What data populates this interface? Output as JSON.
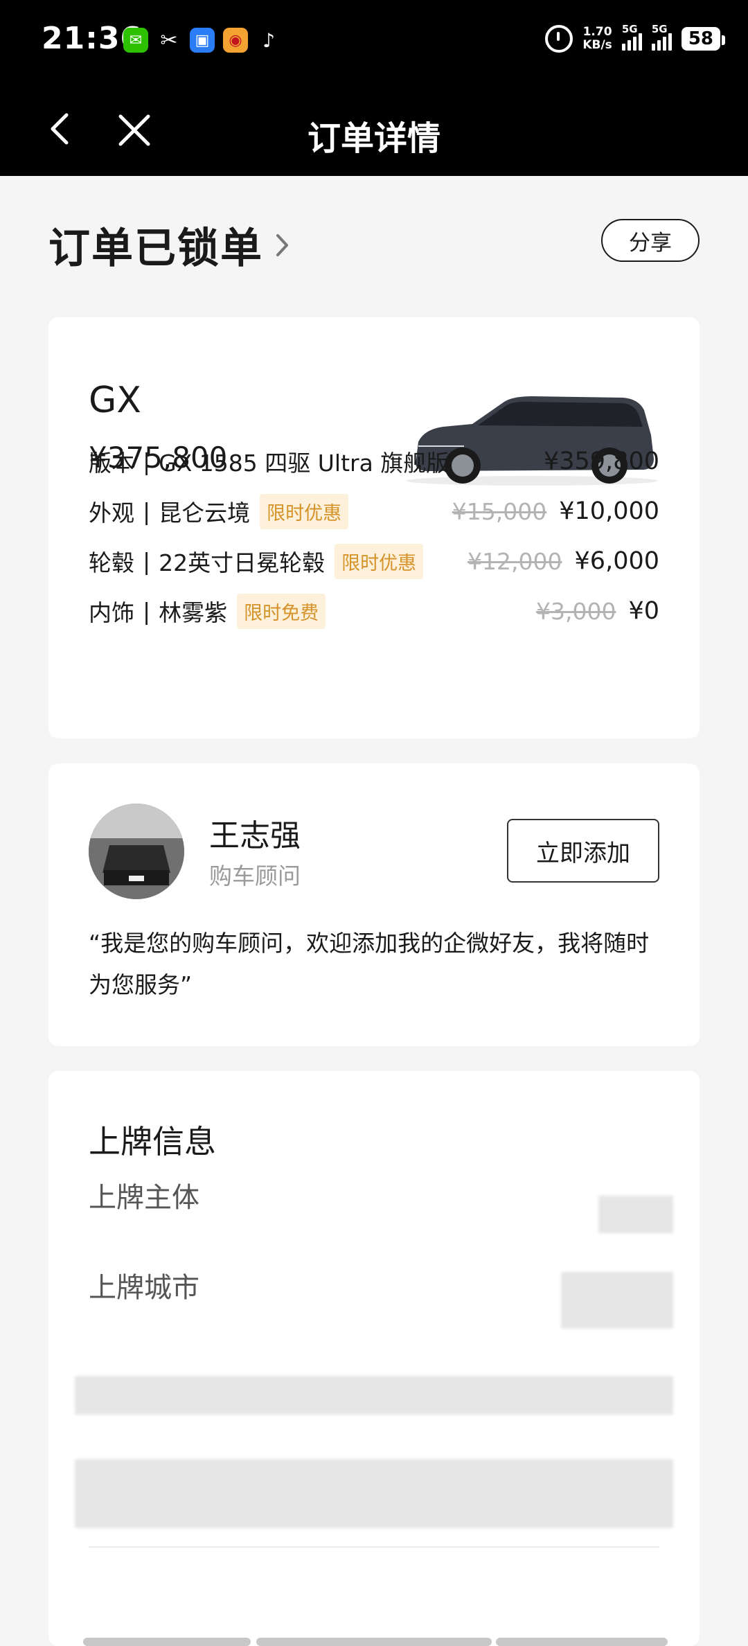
{
  "status_bar": {
    "time": "21:36",
    "net_speed_value": "1.70",
    "net_speed_unit": "KB/s",
    "signal_1": "5G",
    "signal_2": "5G",
    "battery": "58"
  },
  "nav": {
    "title": "订单详情"
  },
  "header": {
    "status": "订单已锁单",
    "share_label": "分享"
  },
  "order": {
    "model": "GX",
    "total": "¥375,800",
    "config": [
      {
        "key": "版本",
        "value": "GX 1585 四驱 Ultra 旗舰版",
        "tag": "",
        "old_price": "",
        "price": "¥359,800"
      },
      {
        "key": "外观",
        "value": "昆仑云境",
        "tag": "限时优惠",
        "old_price": "¥15,000",
        "price": "¥10,000"
      },
      {
        "key": "轮毂",
        "value": "22英寸日冕轮毂",
        "tag": "限时优惠",
        "old_price": "¥12,000",
        "price": "¥6,000"
      },
      {
        "key": "内饰",
        "value": "林雾紫",
        "tag": "限时免费",
        "old_price": "¥3,000",
        "price": "¥0"
      }
    ],
    "separator": "|"
  },
  "advisor": {
    "name": "王志强",
    "role": "购车顾问",
    "add_label": "立即添加",
    "quote": "“我是您的购车顾问，欢迎添加我的企微好友，我将随时为您服务”"
  },
  "plate": {
    "title": "上牌信息",
    "subject_label": "上牌主体",
    "city_label": "上牌城市"
  },
  "colors": {
    "accent_tag_bg": "#fdf1dc",
    "accent_tag_text": "#d5932a",
    "header_bg": "#000000"
  },
  "icons": [
    "back-icon",
    "close-icon",
    "chevron-right-icon",
    "alarm-icon",
    "car-image"
  ]
}
